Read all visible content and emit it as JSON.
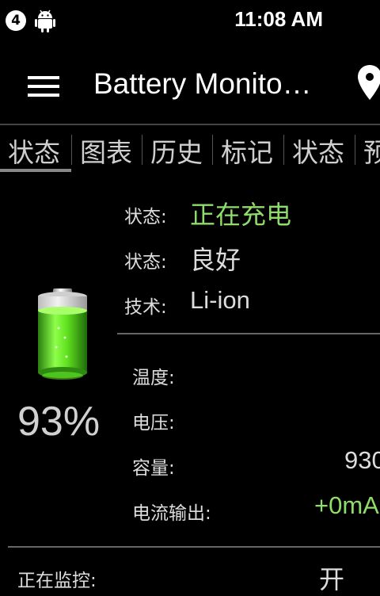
{
  "statusbar": {
    "notification_count": "4",
    "time": "11:08 AM"
  },
  "appbar": {
    "title": "Battery Monito…",
    "icons": [
      "menu-icon",
      "location-pin-icon"
    ]
  },
  "tabs": [
    {
      "label": "状态",
      "active": true
    },
    {
      "label": "图表"
    },
    {
      "label": "历史"
    },
    {
      "label": "标记"
    },
    {
      "label": "状态"
    },
    {
      "label": "预"
    }
  ],
  "battery": {
    "percent": "93%",
    "icon": "battery-icon"
  },
  "status": {
    "status_label": "状态:",
    "status_value": "正在充电",
    "health_label": "状态:",
    "health_value": "良好",
    "tech_label": "技术:",
    "tech_value": "Li-ion"
  },
  "metrics": {
    "temperature_label": "温度:",
    "voltage_label": "电压:",
    "capacity_label": "容量:",
    "capacity_value": "930",
    "current_label": "电流输出:",
    "current_value": "+0mA"
  },
  "monitoring": {
    "label": "正在监控:",
    "value": "开"
  },
  "colors": {
    "accent_green": "#8fdc6b",
    "background": "#000000"
  }
}
